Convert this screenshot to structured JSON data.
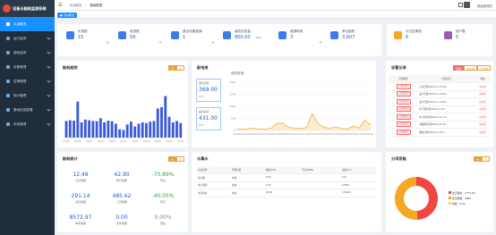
{
  "app": {
    "title": "设备与能耗监测系统"
  },
  "sidebar": {
    "items": [
      {
        "label": "平台概况"
      },
      {
        "label": "运行监测"
      },
      {
        "label": "能耗监测"
      },
      {
        "label": "设备管理"
      },
      {
        "label": "告警管理"
      },
      {
        "label": "统计管理"
      },
      {
        "label": "基础信息配置"
      },
      {
        "label": "系统管理"
      }
    ]
  },
  "header": {
    "breadcrumb_home": "平台概况",
    "breadcrumb_current": "基础数据",
    "user": "超级管理员"
  },
  "tabs": [
    {
      "label": "平台概况"
    }
  ],
  "stats": [
    {
      "label": "水表数",
      "value": "15"
    },
    {
      "label": "电表数",
      "value": "59"
    },
    {
      "label": "重点设备档案",
      "value": "1"
    },
    {
      "label": "装机总容量",
      "value": "800.00"
    },
    {
      "label": "能源种类",
      "value": "3"
    },
    {
      "label": "单位面积",
      "value": "3.607"
    }
  ],
  "stats_units": {
    "capacity": "kVA",
    "area": "kWh/m²"
  },
  "stats_right": [
    {
      "label": "今日告警档",
      "value": "6"
    },
    {
      "label": "用户数",
      "value": "5"
    }
  ],
  "energy_trend": {
    "title": "能耗趋势",
    "toggle": [
      "日",
      "月"
    ]
  },
  "distribution": {
    "title": "配电房",
    "subtitle": "实时负荷",
    "cards": [
      {
        "label": "运行负荷",
        "value": "369.00",
        "unit": "kVA"
      },
      {
        "label": "最高负荷",
        "value": "431.00",
        "unit": "kVA"
      }
    ]
  },
  "alarms": {
    "title": "告警记录",
    "filters": [
      "全部",
      "未处理",
      "已处理"
    ],
    "headers": [
      "告警类型",
      "告警信息",
      "状态"
    ],
    "rows": [
      {
        "type": "一般告警",
        "msg": "正泰告警2023-11-13 00...",
        "status": "未处理"
      },
      {
        "type": "一般告警",
        "msg": "设计告警2023-11-13 00...",
        "status": "未处理"
      },
      {
        "type": "一般告警",
        "msg": "设计告警2023-11-13 00...",
        "status": "未处理"
      },
      {
        "type": "一般告警",
        "msg": "生产楼告警2023-11-13...",
        "status": "未处理"
      },
      {
        "type": "一般告警",
        "msg": "B1 配电告警2023-11-13...",
        "status": "未处理"
      },
      {
        "type": "一般告警",
        "msg": "2楼能耗告警2023-11-13...",
        "status": "未处理"
      },
      {
        "type": "一般告警",
        "msg": "能耗告警2023-11-13 0...",
        "status": "未处理"
      }
    ]
  },
  "energy_stats": {
    "title": "能耗统计",
    "toggle": [
      "日",
      "月"
    ],
    "metrics": [
      {
        "value": "12.49",
        "label": "今日用量"
      },
      {
        "value": "42.90",
        "label": "昨日用量"
      },
      {
        "value": "-70.89%",
        "label": "环比"
      },
      {
        "value": "291.14",
        "label": "当月用量"
      },
      {
        "value": "485.62",
        "label": "上月用量"
      },
      {
        "value": "-40.05%",
        "label": "环比"
      },
      {
        "value": "8572.97",
        "label": "本年用量"
      },
      {
        "value": "0.00",
        "label": "去年用量"
      },
      {
        "value": "0.00%",
        "label": "同比"
      }
    ]
  },
  "water": {
    "title": "水集水",
    "headers": [
      "水表名称",
      "开始水量",
      "电量(kW)",
      "压力(MPa)",
      "水量(m³)"
    ],
    "rows": [
      [
        "综合楼",
        "在线",
        "0.00",
        "",
        "212"
      ],
      [
        "地上能耗",
        "在线",
        "0.00",
        "",
        "12887"
      ],
      [
        "生活用水",
        "在线",
        "18.00",
        "",
        "174400"
      ]
    ]
  },
  "share": {
    "title": "分项用能",
    "toggle": [
      "日",
      "月"
    ],
    "legend": [
      {
        "label": "生活用水：2772.00"
      },
      {
        "label": "生活用电：2860"
      },
      {
        "label": "供暖：0.00"
      }
    ]
  },
  "chart_data": [
    {
      "type": "bar",
      "title": "能耗趋势",
      "categories": [
        "01/12",
        "01/13",
        "01/14",
        "01/15",
        "01/16",
        "01/17",
        "01/18",
        "01/19",
        "01/20",
        "01/21",
        "01/22",
        "01/23",
        "01/24",
        "01/25",
        "01/26",
        "01/27",
        "01/28",
        "01/29",
        "01/30",
        "01/31",
        "02/01",
        "02/02",
        "02/03",
        "02/04",
        "02/05",
        "02/06",
        "02/07",
        "02/08",
        "02/09",
        "02/10",
        "02/11"
      ],
      "values": [
        120,
        125,
        122,
        260,
        110,
        130,
        125,
        120,
        118,
        140,
        110,
        122,
        118,
        100,
        60,
        55,
        95,
        115,
        80,
        100,
        110,
        105,
        115,
        120,
        210,
        220,
        300,
        150,
        110,
        120,
        105
      ],
      "ylim": [
        0,
        400
      ]
    },
    {
      "type": "area",
      "title": "实时负荷",
      "x": [
        "00:00",
        "01:00",
        "02:00",
        "03:00",
        "04:00",
        "05:00",
        "06:00",
        "07:00",
        "08:00",
        "09:00",
        "10:00",
        "11:00",
        "12:00",
        "13:00",
        "14:00",
        "15:00",
        "16:00",
        "17:00",
        "18:00",
        "19:00",
        "20:00",
        "21:00",
        "22:00",
        "23:00"
      ],
      "values": [
        60,
        50,
        70,
        100,
        55,
        60,
        90,
        300,
        300,
        120,
        100,
        80,
        120,
        700,
        280,
        130,
        90,
        150,
        80,
        60,
        180,
        100,
        420,
        230
      ],
      "ylim": [
        0,
        2000
      ],
      "yticks": [
        0,
        500,
        1000,
        1500,
        2000
      ]
    },
    {
      "type": "pie",
      "title": "分项用能",
      "labels": [
        "生活用水",
        "生活用电",
        "供暖"
      ],
      "values": [
        2772,
        2860,
        0.01
      ],
      "colors": [
        "#f0483e",
        "#f5a623",
        "#f6d365"
      ]
    }
  ]
}
